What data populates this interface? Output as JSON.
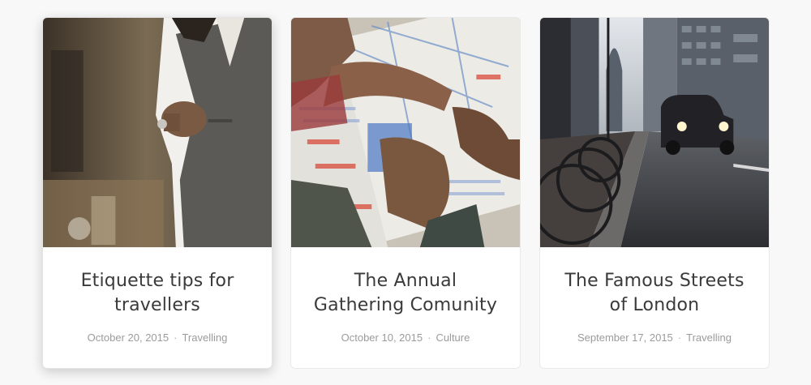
{
  "posts": [
    {
      "title": "Etiquette tips for travellers",
      "date": "October 20, 2015",
      "separator": "·",
      "category": "Travelling"
    },
    {
      "title": "The Annual Gathering Comunity",
      "date": "October 10, 2015",
      "separator": "·",
      "category": "Culture"
    },
    {
      "title": "The Famous Streets of London",
      "date": "September 17, 2015",
      "separator": "·",
      "category": "Travelling"
    }
  ]
}
